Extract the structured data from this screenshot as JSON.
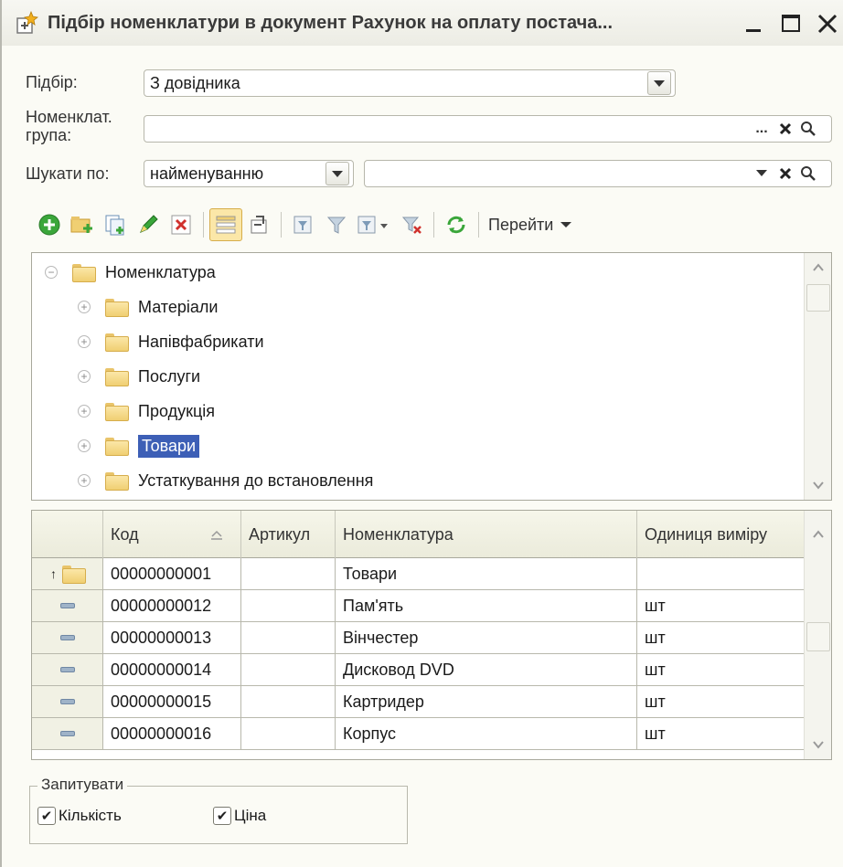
{
  "window": {
    "title": "Підбір номенклатури в документ Рахунок на оплату постача...",
    "buttons": {
      "minimize": "_",
      "maximize": "☐",
      "close": "✕"
    }
  },
  "filters": {
    "selection_label": "Підбір:",
    "selection_value": "З довідника",
    "group_label_line1": "Номенклат.",
    "group_label_line2": "група:",
    "group_value": "",
    "group_buttons": {
      "choose": "...",
      "clear": "✕",
      "search": "🔍"
    },
    "search_by_label": "Шукати по:",
    "search_by_value": "найменуванню",
    "search_value": ""
  },
  "toolbar": {
    "go_to_label": "Перейти",
    "icons": [
      "add-icon",
      "add-group-icon",
      "copy-icon",
      "edit-icon",
      "delete-icon",
      "hierarchy-toggle-icon",
      "level-up-icon",
      "filter-settings-icon",
      "filter-icon",
      "filter-history-icon",
      "clear-filter-icon",
      "refresh-icon"
    ]
  },
  "tree": {
    "root": "Номенклатура",
    "items": [
      {
        "label": "Матеріали"
      },
      {
        "label": "Напівфабрикати"
      },
      {
        "label": "Послуги"
      },
      {
        "label": "Продукція"
      },
      {
        "label": "Товари",
        "selected": true
      },
      {
        "label": "Устаткування до встановлення"
      }
    ]
  },
  "grid": {
    "columns": [
      "",
      "Код",
      "Артикул",
      "Номенклатура",
      "Одиниця виміру"
    ],
    "rows": [
      {
        "type": "group",
        "code": "00000000001",
        "article": "",
        "name": "Товари",
        "unit": ""
      },
      {
        "type": "item",
        "code": "00000000012",
        "article": "",
        "name": "Пам'ять",
        "unit": "шт"
      },
      {
        "type": "item",
        "code": "00000000013",
        "article": "",
        "name": "Вінчестер",
        "unit": "шт"
      },
      {
        "type": "item",
        "code": "00000000014",
        "article": "",
        "name": "Дисковод DVD",
        "unit": "шт"
      },
      {
        "type": "item",
        "code": "00000000015",
        "article": "",
        "name": "Картридер",
        "unit": "шт"
      },
      {
        "type": "item",
        "code": "00000000016",
        "article": "",
        "name": "Корпус",
        "unit": "шт"
      }
    ]
  },
  "request": {
    "legend": "Запитувати",
    "quantity_label": "Кількість",
    "quantity_checked": true,
    "price_label": "Ціна",
    "price_checked": true
  },
  "colors": {
    "selection": "#3d5fb6",
    "folder": "#f0cf72",
    "add_green": "#3aa63a",
    "delete_red": "#d0312d"
  }
}
